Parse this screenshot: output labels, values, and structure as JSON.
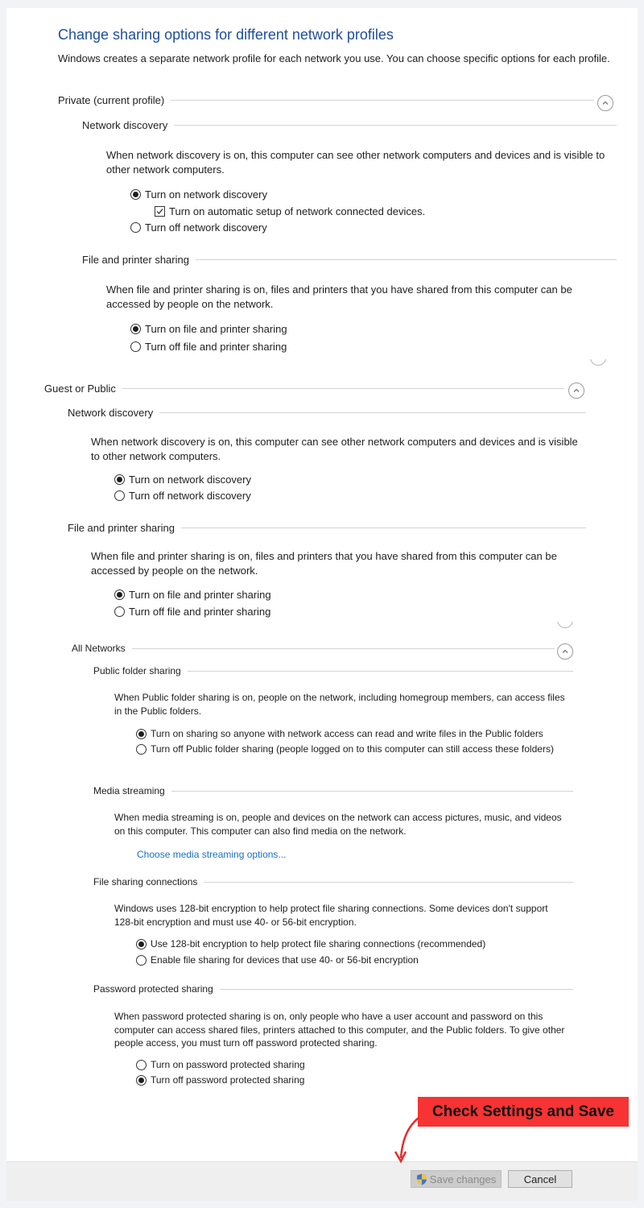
{
  "title": "Change sharing options for different network profiles",
  "intro": "Windows creates a separate network profile for each network you use. You can choose specific options for each profile.",
  "private": {
    "label": "Private (current profile)",
    "network_discovery": {
      "label": "Network discovery",
      "description": "When network discovery is on, this computer can see other network computers and devices and is visible to other network computers.",
      "on": "Turn on network discovery",
      "auto_setup": "Turn on automatic setup of network connected devices.",
      "off": "Turn off network discovery",
      "selected": "on",
      "auto_setup_checked": true
    },
    "file_printer": {
      "label": "File and printer sharing",
      "description": "When file and printer sharing is on, files and printers that you have shared from this computer can be accessed by people on the network.",
      "on": "Turn on file and printer sharing",
      "off": "Turn off file and printer sharing",
      "selected": "on"
    }
  },
  "guest": {
    "label": "Guest or Public",
    "network_discovery": {
      "label": "Network discovery",
      "description": "When network discovery is on, this computer can see other network computers and devices and is visible to other network computers.",
      "on": "Turn on network discovery",
      "off": "Turn off network discovery",
      "selected": "on"
    },
    "file_printer": {
      "label": "File and printer sharing",
      "description": "When file and printer sharing is on, files and printers that you have shared from this computer can be accessed by people on the network.",
      "on": "Turn on file and printer sharing",
      "off": "Turn off file and printer sharing",
      "selected": "on"
    }
  },
  "all": {
    "label": "All Networks",
    "public_folder": {
      "label": "Public folder sharing",
      "description": "When Public folder sharing is on, people on the network, including homegroup members, can access files in the Public folders.",
      "on": "Turn on sharing so anyone with network access can read and write files in the Public folders",
      "off": "Turn off Public folder sharing (people logged on to this computer can still access these folders)",
      "selected": "on"
    },
    "media": {
      "label": "Media streaming",
      "description": "When media streaming is on, people and devices on the network can access pictures, music, and videos on this computer. This computer can also find media on the network.",
      "link": "Choose media streaming options..."
    },
    "file_conn": {
      "label": "File sharing connections",
      "description": "Windows uses 128-bit encryption to help protect file sharing connections. Some devices don't support 128-bit encryption and must use 40- or 56-bit encryption.",
      "opt128": "Use 128-bit encryption to help protect file sharing connections (recommended)",
      "opt40": "Enable file sharing for devices that use 40- or 56-bit encryption",
      "selected": "128"
    },
    "password": {
      "label": "Password protected sharing",
      "description": "When password protected sharing is on, only people who have a user account and password on this computer can access shared files, printers attached to this computer, and the Public folders. To give other people access, you must turn off password protected sharing.",
      "on": "Turn on password protected sharing",
      "off": "Turn off password protected sharing",
      "selected": "off"
    }
  },
  "footer": {
    "save": "Save changes",
    "cancel": "Cancel"
  },
  "annotation": {
    "text": "Check Settings and Save",
    "color": "#f73333"
  },
  "colors": {
    "title": "#1f4e9c",
    "link": "#1a6fc4"
  }
}
